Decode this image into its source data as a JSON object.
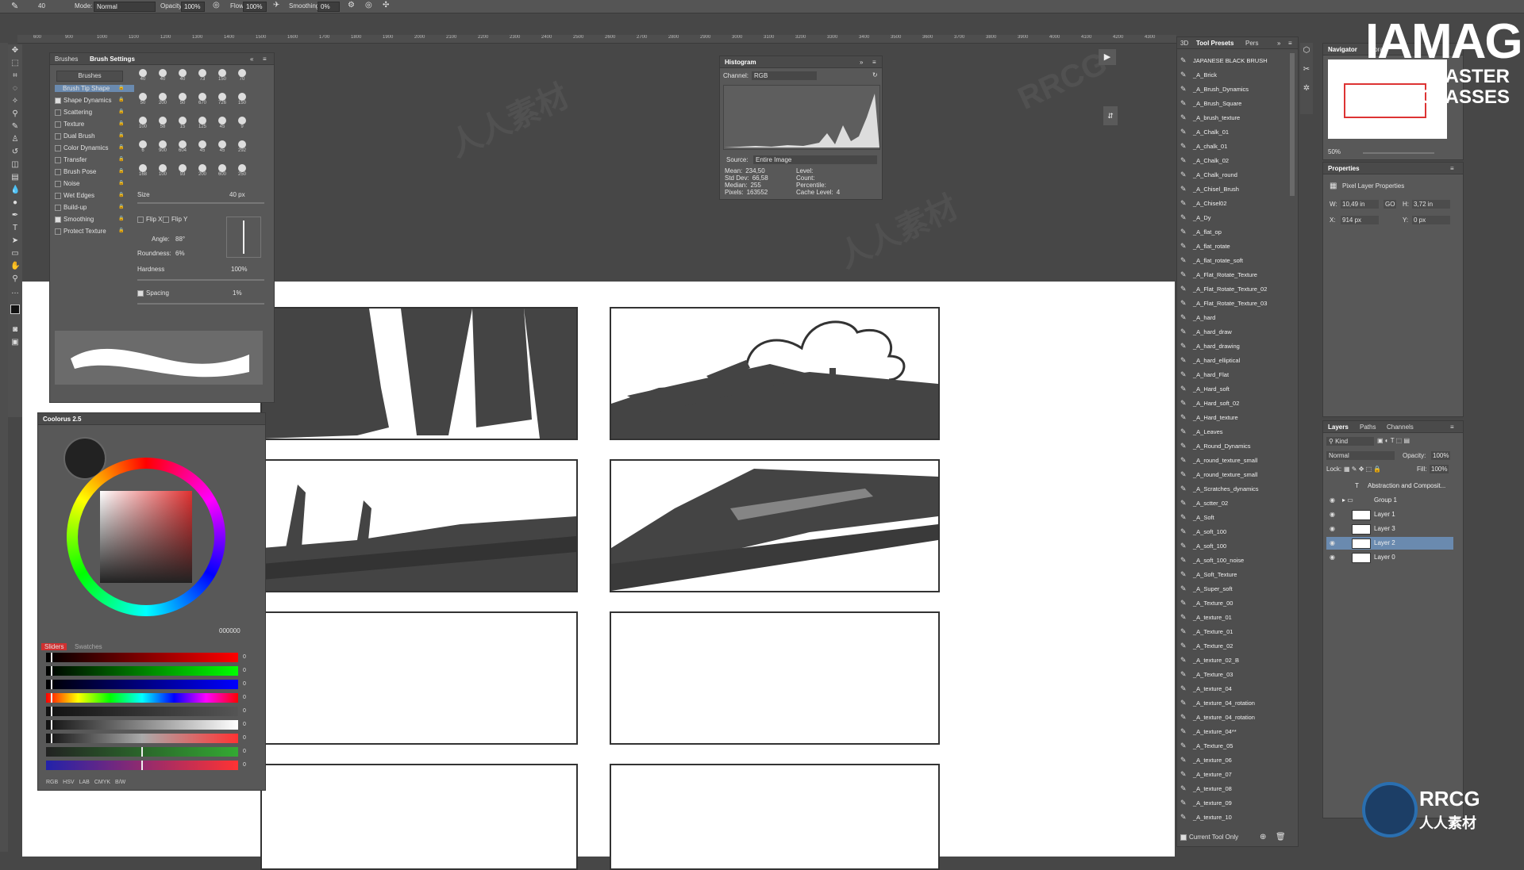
{
  "options_bar": {
    "brush_size": "40",
    "mode_label": "Mode:",
    "mode_value": "Normal",
    "opacity_label": "Opacity:",
    "opacity_value": "100%",
    "flow_label": "Flow:",
    "flow_value": "100%",
    "smoothing_label": "Smoothing:",
    "smoothing_value": "0%"
  },
  "ruler_ticks": [
    "600",
    "900",
    "1000",
    "1100",
    "1200",
    "1300",
    "1400",
    "1500",
    "1600",
    "1700",
    "1800",
    "1900",
    "2000",
    "2100",
    "2200",
    "2300",
    "2400",
    "2500",
    "2600",
    "2700",
    "2800",
    "2900",
    "3000",
    "3100",
    "3200",
    "3300",
    "3400",
    "3500",
    "3600",
    "3700",
    "3800",
    "3900",
    "4000",
    "4100",
    "4200",
    "4300"
  ],
  "brush_panel": {
    "tab_brushes": "Brushes",
    "tab_settings": "Brush Settings",
    "brushes_button": "Brushes",
    "options": [
      {
        "label": "Brush Tip Shape",
        "checked": null,
        "active": true
      },
      {
        "label": "Shape Dynamics",
        "checked": true
      },
      {
        "label": "Scattering",
        "checked": false
      },
      {
        "label": "Texture",
        "checked": false
      },
      {
        "label": "Dual Brush",
        "checked": false
      },
      {
        "label": "Color Dynamics",
        "checked": false
      },
      {
        "label": "Transfer",
        "checked": false
      },
      {
        "label": "Brush Pose",
        "checked": false
      },
      {
        "label": "Noise",
        "checked": false
      },
      {
        "label": "Wet Edges",
        "checked": false
      },
      {
        "label": "Build-up",
        "checked": false
      },
      {
        "label": "Smoothing",
        "checked": true
      },
      {
        "label": "Protect Texture",
        "checked": false
      }
    ],
    "brush_sizes": [
      "40",
      "40",
      "40",
      "73",
      "150",
      "70",
      "50",
      "200",
      "50",
      "670",
      "726",
      "150",
      "100",
      "58",
      "15",
      "125",
      "45",
      "9",
      "6",
      "900",
      "604",
      "45",
      "45",
      "292",
      "168",
      "100",
      "93",
      "200",
      "600",
      "250"
    ],
    "size_label": "Size",
    "size_value": "40 px",
    "flip_x": "Flip X",
    "flip_y": "Flip Y",
    "angle_label": "Angle:",
    "angle_value": "88°",
    "roundness_label": "Roundness:",
    "roundness_value": "6%",
    "hardness_label": "Hardness",
    "hardness_value": "100%",
    "spacing_label": "Spacing",
    "spacing_value": "1%"
  },
  "histogram": {
    "title": "Histogram",
    "channel_label": "Channel:",
    "channel_value": "RGB",
    "source_label": "Source:",
    "source_value": "Entire Image",
    "stats_left": [
      {
        "k": "Mean:",
        "v": "234,50"
      },
      {
        "k": "Std Dev:",
        "v": "66,58"
      },
      {
        "k": "Median:",
        "v": "255"
      },
      {
        "k": "Pixels:",
        "v": "163552"
      }
    ],
    "stats_right": [
      {
        "k": "Level:",
        "v": ""
      },
      {
        "k": "Count:",
        "v": ""
      },
      {
        "k": "Percentile:",
        "v": ""
      },
      {
        "k": "Cache Level:",
        "v": "4"
      }
    ]
  },
  "coolorus": {
    "title": "Coolorus 2.5",
    "hex_value": "000000",
    "tab_sliders": "Sliders",
    "tab_swatches": "Swatches",
    "slider_values": [
      "0",
      "0",
      "0",
      "0",
      "0",
      "0",
      "0",
      "0",
      "0"
    ],
    "modes": [
      "RGB",
      "HSV",
      "LAB",
      "CMYK",
      "B/W"
    ]
  },
  "tool_presets": {
    "tab_3d": "3D",
    "tab_presets": "Tool Presets",
    "tab_pers": "Pers",
    "items": [
      "JAPANESE BLACK BRUSH",
      "_A_Brick",
      "_A_Brush_Dynamics",
      "_A_Brush_Square",
      "_A_brush_texture",
      "_A_Chalk_01",
      "_A_chalk_01",
      "_A_Chalk_02",
      "_A_Chalk_round",
      "_A_Chisel_Brush",
      "_A_Chisel02",
      "_A_Dy",
      "_A_flat_op",
      "_A_flat_rotate",
      "_A_flat_rotate_soft",
      "_A_Flat_Rotate_Texture",
      "_A_Flat_Rotate_Texture_02",
      "_A_Flat_Rotate_Texture_03",
      "_A_hard",
      "_A_hard_draw",
      "_A_hard_drawing",
      "_A_hard_elliptical",
      "_A_hard_Flat",
      "_A_Hard_soft",
      "_A_Hard_soft_02",
      "_A_Hard_texture",
      "_A_Leaves",
      "_A_Round_Dynamics",
      "_A_round_texture_small",
      "_A_round_texture_small",
      "_A_Scratches_dynamics",
      "_A_sctter_02",
      "_A_Soft",
      "_A_soft_100",
      "_A_soft_100",
      "_A_soft_100_noise",
      "_A_Soft_Texture",
      "_A_Super_soft",
      "_A_Texture_00",
      "_A_texture_01",
      "_A_Texture_01",
      "_A_Texture_02",
      "_A_texture_02_B",
      "_A_Texture_03",
      "_A_texture_04",
      "_A_texture_04_rotation",
      "_A_texture_04_rotation",
      "_A_texture_04**",
      "_A_Texture_05",
      "_A_texture_06",
      "_A_texture_07",
      "_A_texture_08",
      "_A_texture_09",
      "_A_texture_10"
    ],
    "current_tool_only": "Current Tool Only"
  },
  "navigator": {
    "tab_navigator": "Navigator",
    "tab_libraries": "Librari",
    "zoom": "50%"
  },
  "properties": {
    "title": "Properties",
    "subtitle": "Pixel Layer Properties",
    "w_label": "W:",
    "w_value": "10,49 in",
    "h_label": "H:",
    "h_value": "3,72 in",
    "x_label": "X:",
    "x_value": "914 px",
    "y_label": "Y:",
    "y_value": "0 px",
    "link_label": "GO"
  },
  "layers": {
    "tab_layers": "Layers",
    "tab_paths": "Paths",
    "tab_channels": "Channels",
    "kind": "Kind",
    "blend": "Normal",
    "opacity_label": "Opacity:",
    "opacity_value": "100%",
    "lock_label": "Lock:",
    "fill_label": "Fill:",
    "fill_value": "100%",
    "items": [
      {
        "name": "Abstraction and Composit...",
        "type": "text",
        "visible": false,
        "selected": false
      },
      {
        "name": "Group 1",
        "type": "group",
        "visible": true,
        "selected": false
      },
      {
        "name": "Layer 1",
        "type": "layer",
        "visible": true,
        "selected": false
      },
      {
        "name": "Layer 3",
        "type": "layer",
        "visible": true,
        "selected": false
      },
      {
        "name": "Layer 2",
        "type": "layer",
        "visible": true,
        "selected": true
      },
      {
        "name": "Layer 0",
        "type": "layer",
        "visible": true,
        "selected": false
      }
    ]
  },
  "watermarks": {
    "iamag_1": "IAMAG",
    "iamag_2": "MASTER CLASSES",
    "rrcg": "RRCG",
    "rrcg_cn": "人人素材"
  },
  "colors": {
    "panel_bg": "#585858",
    "canvas_bg": "#ffffff",
    "selection": "#6a8aaf",
    "ink": "#333333"
  }
}
